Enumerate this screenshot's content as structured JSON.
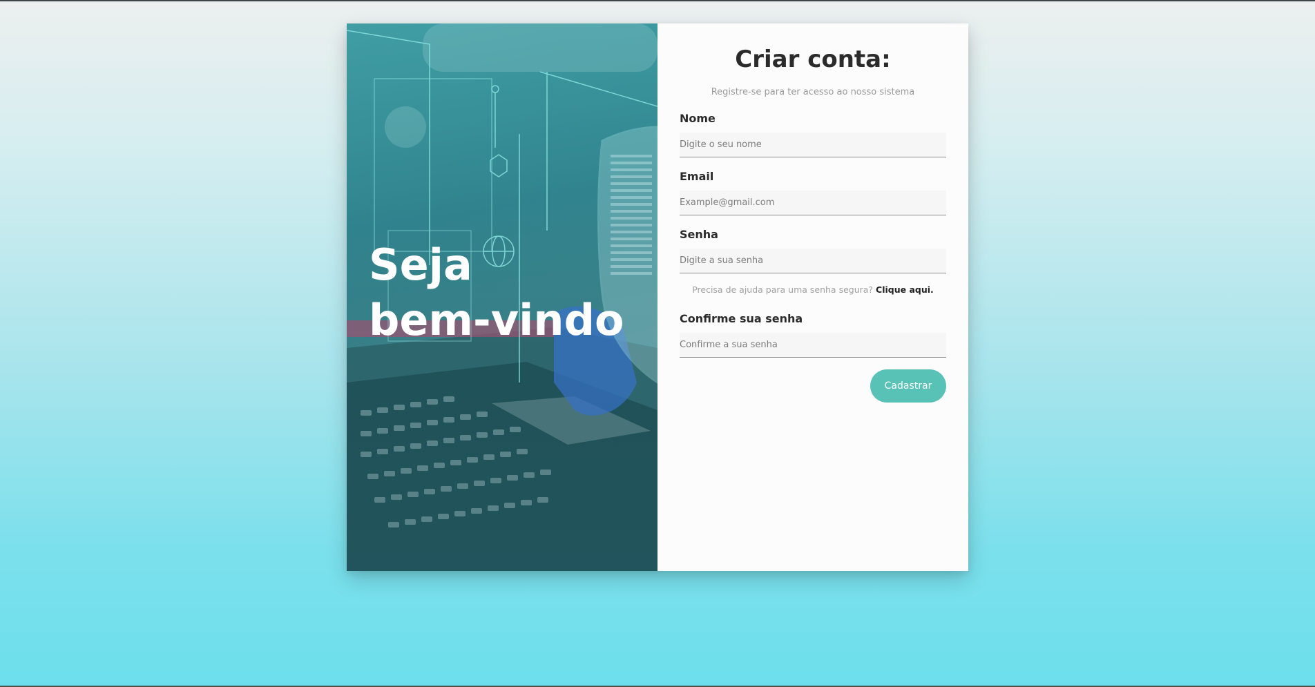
{
  "hero": {
    "title_line1": "Seja",
    "title_line2": "bem-vindo"
  },
  "form": {
    "title": "Criar conta:",
    "subtitle": "Registre-se para ter acesso ao nosso sistema",
    "fields": {
      "name": {
        "label": "Nome",
        "placeholder": "Digite o seu nome",
        "value": ""
      },
      "email": {
        "label": "Email",
        "placeholder": "Example@gmail.com",
        "value": ""
      },
      "password": {
        "label": "Senha",
        "placeholder": "Digite a sua senha",
        "value": ""
      },
      "confirm": {
        "label": "Confirme sua senha",
        "placeholder": "Confirme a sua senha",
        "value": ""
      }
    },
    "help_text": "Precisa de ajuda para uma senha segura?",
    "help_link": "Clique aqui.",
    "submit_label": "Cadastrar"
  },
  "colors": {
    "accent": "#58c2b7",
    "hero_tint": "#2f7f8a",
    "background_bottom": "#6ddfec"
  }
}
